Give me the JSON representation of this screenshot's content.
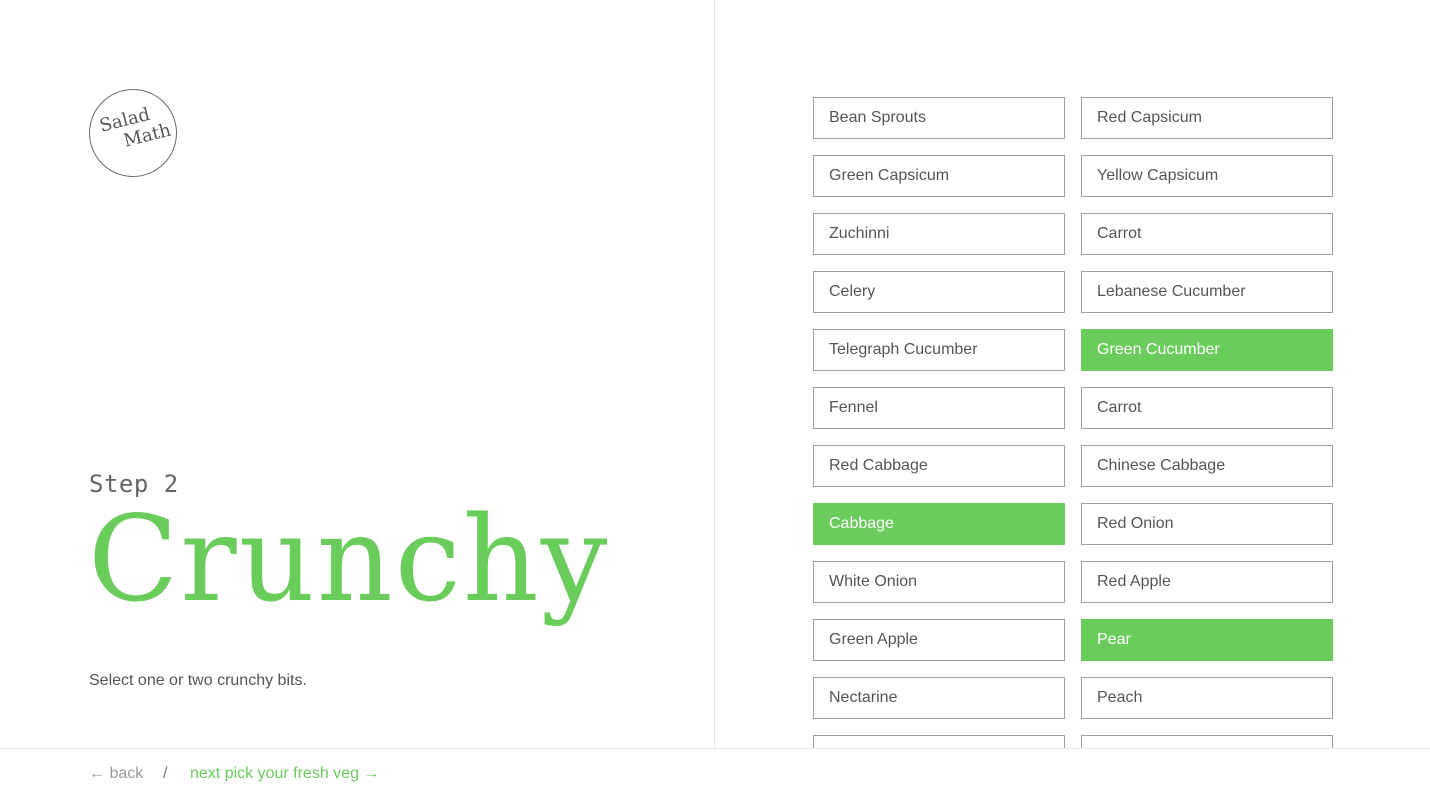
{
  "logo": {
    "line1": "Salad",
    "line2": "Math"
  },
  "step": {
    "label": "Step 2",
    "title": "Crunchy",
    "description": "Select one or two crunchy bits."
  },
  "options": [
    {
      "label": "Bean Sprouts",
      "selected": false
    },
    {
      "label": "Red Capsicum",
      "selected": false
    },
    {
      "label": "Green Capsicum",
      "selected": false
    },
    {
      "label": "Yellow Capsicum",
      "selected": false
    },
    {
      "label": "Zuchinni",
      "selected": false
    },
    {
      "label": "Carrot",
      "selected": false
    },
    {
      "label": "Celery",
      "selected": false
    },
    {
      "label": "Lebanese Cucumber",
      "selected": false
    },
    {
      "label": "Telegraph Cucumber",
      "selected": false
    },
    {
      "label": "Green Cucumber",
      "selected": true
    },
    {
      "label": "Fennel",
      "selected": false
    },
    {
      "label": "Carrot",
      "selected": false
    },
    {
      "label": "Red Cabbage",
      "selected": false
    },
    {
      "label": "Chinese Cabbage",
      "selected": false
    },
    {
      "label": "Cabbage",
      "selected": true
    },
    {
      "label": "Red Onion",
      "selected": false
    },
    {
      "label": "White Onion",
      "selected": false
    },
    {
      "label": "Red Apple",
      "selected": false
    },
    {
      "label": "Green Apple",
      "selected": false
    },
    {
      "label": "Pear",
      "selected": true
    },
    {
      "label": "Nectarine",
      "selected": false
    },
    {
      "label": "Peach",
      "selected": false
    },
    {
      "label": "",
      "selected": false
    },
    {
      "label": "",
      "selected": false
    }
  ],
  "footer": {
    "back_label": "← back",
    "separator": "/",
    "next_label": "next pick your fresh veg →"
  },
  "colors": {
    "accent": "#69cc5b",
    "border": "#9e9e9e",
    "text": "#555555",
    "divider": "#e6e6e6"
  }
}
